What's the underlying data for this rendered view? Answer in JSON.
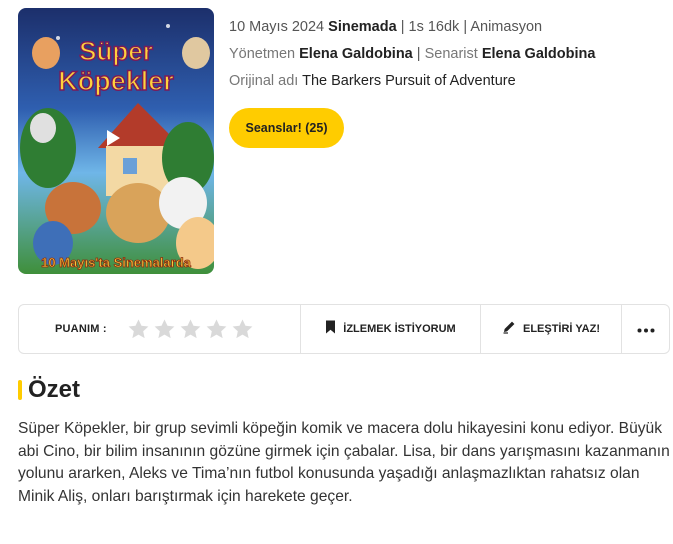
{
  "poster": {
    "title_line1": "Süper",
    "title_line2": "Köpekler",
    "tagline": "10 Mayıs'ta Sinemalarda",
    "play_icon": "play-icon"
  },
  "info": {
    "date": "10 Mayıs 2024",
    "status": "Sinemada",
    "duration": "1s 16dk",
    "genre": "Animasyon",
    "director_label": "Yönetmen",
    "director": "Elena Galdobina",
    "writer_label": "Senarist",
    "writer": "Elena Galdobina",
    "original_label": "Orijinal adı",
    "original_title": "The Barkers Pursuit of Adventure"
  },
  "seans_button": "Seanslar! (25)",
  "actions": {
    "rating_label": "PUANIM :",
    "star_count": 5,
    "rating_value": 0,
    "watch_label": "İZLEMEK İSTİYORUM",
    "critic_label": "ELEŞTİRİ YAZ!",
    "more_icon": "more-horizontal-icon"
  },
  "summary": {
    "title": "Özet",
    "text": "Süper Köpekler, bir grup sevimli köpeğin komik ve macera dolu hikayesini konu ediyor. Büyük abi Cino, bir bilim insanının gözüne girmek için çabalar. Lisa, bir dans yarışmasını kazanmanın yolunu ararken, Aleks ve Tima’nın futbol konusunda yaşadığı anlaşmazlıktan rahatsız olan Minik Aliş, onları barıştırmak için harekete geçer."
  },
  "colors": {
    "accent": "#ffcc00",
    "star_empty": "#d9d9d9"
  }
}
